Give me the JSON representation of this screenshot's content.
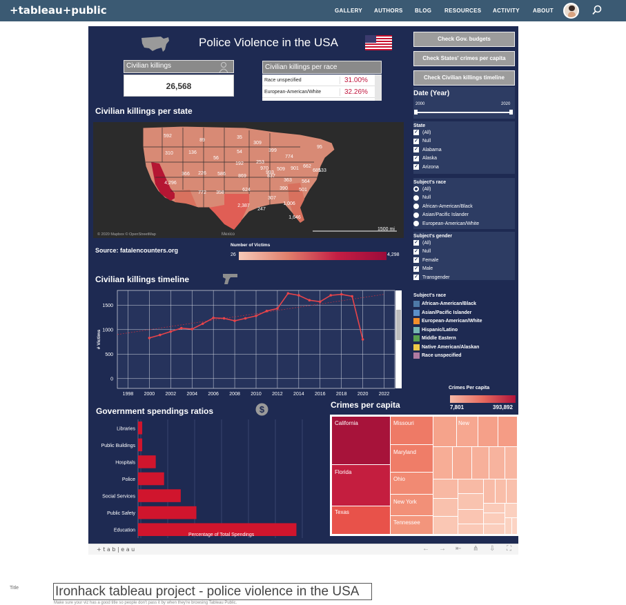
{
  "header": {
    "logo": "+tableau+public",
    "nav": [
      "GALLERY",
      "AUTHORS",
      "BLOG",
      "RESOURCES",
      "ACTIVITY",
      "ABOUT"
    ]
  },
  "dashboard": {
    "title": "Police Violence in the USA",
    "buttons": [
      "Check Gov. budgets",
      "Check States' crimes per capita",
      "Check Civilian killings timeline"
    ],
    "kpi_label": "Civilian killings",
    "kpi_value": "26,568",
    "race_table_title": "Civilian killings per race",
    "race_rows": [
      {
        "label": "Race unspecified",
        "value": "31.00%"
      },
      {
        "label": "European-American/White",
        "value": "32.26%"
      }
    ],
    "map_title": "Civilian killings per state",
    "map_attrib": "© 2020 Mapbox © OpenStreetMap",
    "map_scale": "1500 mi",
    "map_country_label": "Mexico",
    "map_values": [
      "592",
      "89",
      "35",
      "309",
      "310",
      "136",
      "54",
      "399",
      "774",
      "56",
      "192",
      "253",
      "95",
      "869",
      "133",
      "366",
      "226",
      "586",
      "970",
      "837",
      "993",
      "509",
      "901",
      "662",
      "685",
      "4,296",
      "772",
      "358",
      "624",
      "390",
      "363",
      "564",
      "501",
      "2,387",
      "247",
      "307",
      "1,006",
      "1,646"
    ],
    "source": "Source: fatalencounters.org",
    "victims_legend_title": "Number of Victims",
    "victims_min": "26",
    "victims_max": "4,298",
    "filters": {
      "date_title": "Date (Year)",
      "date_min": "2000",
      "date_max": "2020",
      "state_title": "State",
      "state_items": [
        "(All)",
        "Null",
        "Alabama",
        "Alaska",
        "Arizona"
      ],
      "race_title": "Subject's race",
      "race_items": [
        "(All)",
        "Null",
        "African-American/Black",
        "Asian/Pacific Islander",
        "European-American/White"
      ],
      "gender_title": "Subject's gender",
      "gender_items": [
        "(All)",
        "Null",
        "Female",
        "Male",
        "Transgender"
      ]
    },
    "race_legend": {
      "title": "Subject's race",
      "items": [
        {
          "label": "African-American/Black",
          "color": "#4e79a7"
        },
        {
          "label": "Asian/Pacific Islander",
          "color": "#5b8fc9"
        },
        {
          "label": "European-American/White",
          "color": "#f28e2b"
        },
        {
          "label": "Hispanic/Latino",
          "color": "#76b7b2"
        },
        {
          "label": "Middle Eastern",
          "color": "#59a14f"
        },
        {
          "label": "Native American/Alaskan",
          "color": "#edc948"
        },
        {
          "label": "Race unspecified",
          "color": "#b07aa1"
        }
      ]
    },
    "timeline_title": "Civilian killings timeline",
    "gov_title": "Government spendings ratios",
    "crimes_title": "Crimes per capita",
    "crimes_legend_title": "Crimes Per capita",
    "crimes_min": "7,801",
    "crimes_max": "393,892",
    "treemap_labels": [
      "California",
      "Florida",
      "Texas",
      "Missouri",
      "Maryland",
      "Ohio",
      "New York",
      "Tennessee",
      "New"
    ]
  },
  "chart_data": [
    {
      "type": "line",
      "title": "Civilian killings timeline",
      "xlabel": "Date (Year)",
      "ylabel": "# Victims",
      "x": [
        2000,
        2001,
        2002,
        2003,
        2004,
        2005,
        2006,
        2007,
        2008,
        2009,
        2010,
        2011,
        2012,
        2013,
        2014,
        2015,
        2016,
        2017,
        2018,
        2019,
        2020
      ],
      "values": [
        830,
        890,
        960,
        1030,
        1010,
        1120,
        1240,
        1230,
        1180,
        1230,
        1280,
        1380,
        1430,
        1740,
        1700,
        1600,
        1570,
        1700,
        1720,
        1680,
        800
      ],
      "xticks": [
        1998,
        2000,
        2002,
        2004,
        2006,
        2008,
        2010,
        2012,
        2014,
        2016,
        2018,
        2020,
        2022
      ],
      "yticks": [
        0,
        500,
        1000,
        1500
      ],
      "xlim": [
        1997,
        2023
      ],
      "ylim": [
        -200,
        1800
      ],
      "grid": true
    },
    {
      "type": "bar",
      "title": "Government spendings ratios",
      "xlabel": "Percentage of Total Spendings",
      "categories": [
        "Libraries",
        "Public Buildings",
        "Hospitals",
        "Police",
        "Social Services",
        "Public Safety",
        "Education"
      ],
      "values": [
        0.004,
        0.004,
        0.017,
        0.025,
        0.041,
        0.056,
        0.152
      ],
      "xticks": [
        "0.00",
        "0.05",
        "0.10",
        "0.15",
        "0.20",
        "0.25",
        "0.30"
      ],
      "xlim": [
        0,
        0.155
      ],
      "color": "#d0152d",
      "grid": true
    }
  ],
  "toolbar": {
    "brand": "+ t a b | e a u"
  },
  "title_field": {
    "label": "Title",
    "value": "Ironhack tableau project - police violence in the USA",
    "hint": "Make sure your viz has a good title so people don't pass it by when they're browsing Tableau Public."
  }
}
